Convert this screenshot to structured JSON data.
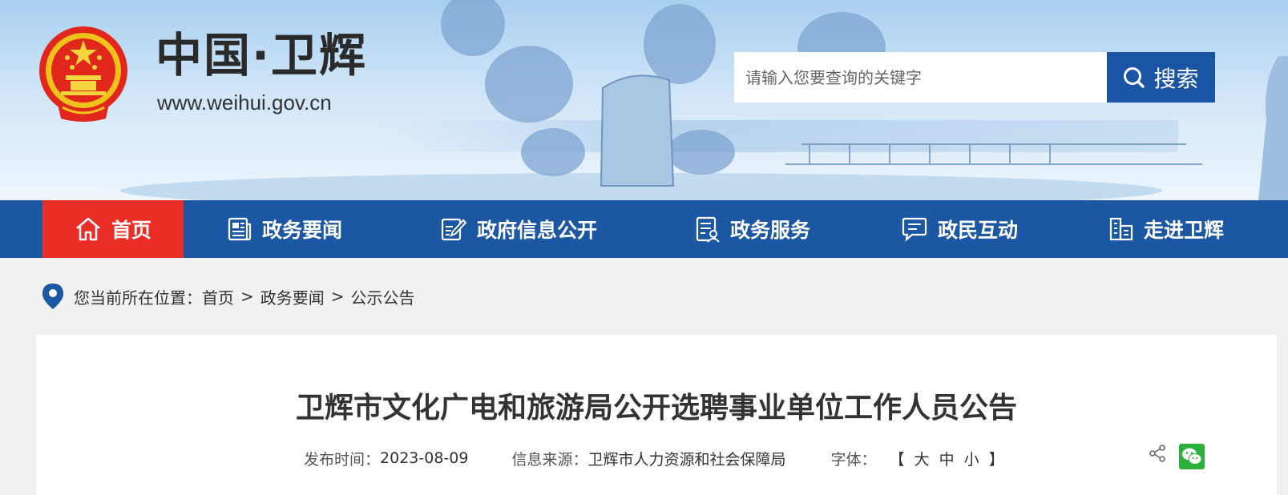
{
  "site": {
    "title": "中国·卫辉",
    "url": "www.weihui.gov.cn"
  },
  "search": {
    "placeholder": "请输入您要查询的关键字",
    "button_label": "搜索"
  },
  "nav": {
    "items": [
      {
        "label": "首页",
        "icon": "home-icon",
        "active": true
      },
      {
        "label": "政务要闻",
        "icon": "newspaper-icon"
      },
      {
        "label": "政府信息公开",
        "icon": "edit-document-icon"
      },
      {
        "label": "政务服务",
        "icon": "service-document-icon"
      },
      {
        "label": "政民互动",
        "icon": "chat-icon"
      },
      {
        "label": "走进卫辉",
        "icon": "buildings-icon"
      }
    ]
  },
  "breadcrumb": {
    "prefix": "您当前所在位置：",
    "items": [
      "首页",
      "政务要闻",
      "公示公告"
    ],
    "separator": ">"
  },
  "article": {
    "title": "卫辉市文化广电和旅游局公开选聘事业单位工作人员公告",
    "publish_label": "发布时间：",
    "publish_date": "2023-08-09",
    "source_label": "信息来源：",
    "source": "卫辉市人力资源和社会保障局",
    "font_label": "字体：",
    "font_open": "【",
    "font_large": "大",
    "font_medium": "中",
    "font_small": "小",
    "font_close": "】"
  },
  "colors": {
    "nav_bg": "#1b57a3",
    "nav_active": "#ea2d26",
    "search_button": "#1a55a5",
    "wechat": "#2bb13a"
  }
}
